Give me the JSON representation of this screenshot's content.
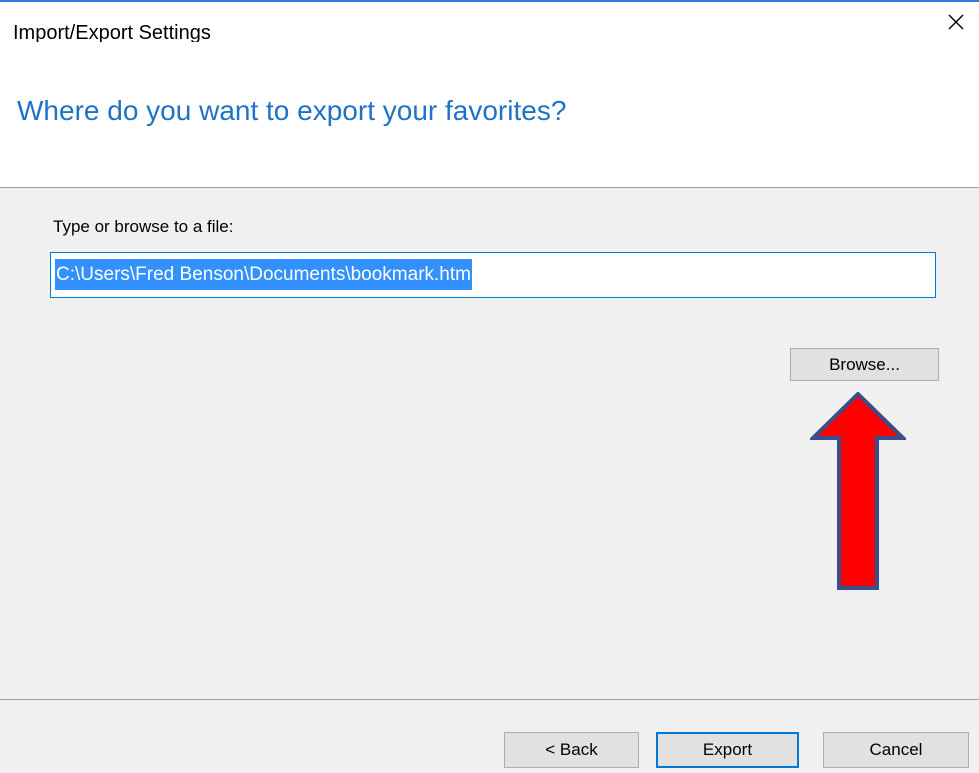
{
  "window": {
    "title": "Import/Export Settings"
  },
  "header": {
    "question": "Where do you want to export your favorites?"
  },
  "form": {
    "label": "Type or browse to a file:",
    "path_value": "C:\\Users\\Fred Benson\\Documents\\bookmark.htm",
    "browse_label": "Browse..."
  },
  "footer": {
    "back_label": "< Back",
    "export_label": "Export",
    "cancel_label": "Cancel"
  },
  "colors": {
    "accent": "#1f72c6",
    "selection": "#3390ff",
    "annotation_arrow_fill": "#ff0000",
    "annotation_arrow_stroke": "#3a4f8a"
  },
  "icons": {
    "close": "close-icon",
    "annotation": "up-arrow-annotation"
  }
}
